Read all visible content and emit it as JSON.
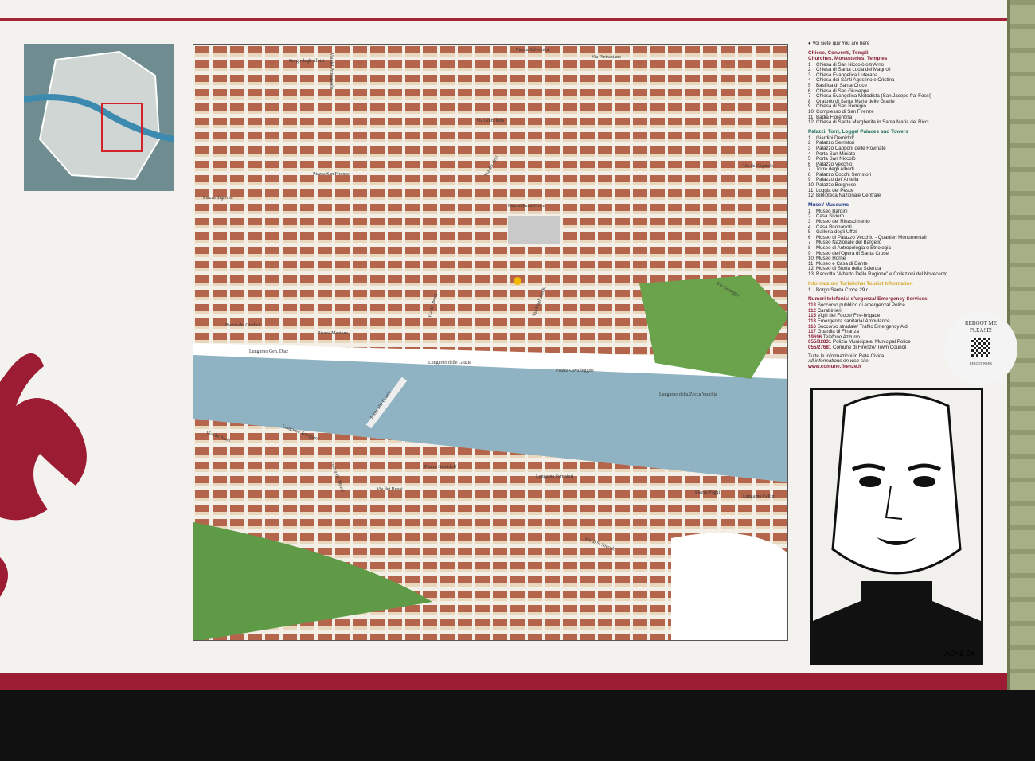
{
  "legend": {
    "you_are_here": "Voi siete qui/ You are here",
    "churches": {
      "title_it": "Chiese, Conventi, Templi",
      "title_en": "Churches, Monasteries, Temples",
      "items": [
        "Chiesa di San Niccolò oltr'Arno",
        "Chiesa di Santa Lucia dei Magnoli",
        "Chiesa Evangelica Luterana",
        "Chiesa dei Santi Agostino e Cristina",
        "Basilica di Santa Croce",
        "Chiesa di San Giuseppe",
        "Chiesa Evangelica Metodista (San Jacopo fra' Fossi)",
        "Oratorio di Santa Maria delle Grazie",
        "Chiesa di San Remigio",
        "Complesso di San Firenze",
        "Badia Fiorentina",
        "Chiesa di Santa Margherita in Santa Maria de' Ricci"
      ]
    },
    "palaces": {
      "title": "Palazzi, Torri, Logge/ Palaces and Towers",
      "items": [
        "Giardini Demidoff",
        "Palazzo Serristori",
        "Palazzo Capponi delle Rovinate",
        "Porta San Miniato",
        "Porta San Niccolò",
        "Palazzo Vecchio",
        "Torre degli Alberti",
        "Palazzo Cocchi Serristori",
        "Palazzo dell'Antella",
        "Palazzo Borghese",
        "Loggia del Pesce",
        "Biblioteca Nazionale Centrale"
      ]
    },
    "museums": {
      "title": "Musei/ Museums",
      "items": [
        "Museo Bardini",
        "Casa Siviero",
        "Museo del Rinascimento",
        "Casa Buonarroti",
        "Galleria degli Uffizi",
        "Museo di Palazzo Vecchio - Quartieri Monumentali",
        "Museo Nazionale del Bargello",
        "Museo di Antropologia e Etnologia",
        "Museo dell'Opera di Santa Croce",
        "Museo Horne",
        "Museo e Casa di Dante",
        "Museo di Storia della Scienza",
        "Raccolta \"Alberto Della Ragione\" e Collezioni del Novecento"
      ]
    },
    "tourist": {
      "title": "Informazioni Turistiche/ Tourist Information",
      "items": [
        "Borgo Santa Croce 29 r"
      ]
    },
    "emergency": {
      "title": "Numeri telefonici d'urgenza/ Emergency Services",
      "items": [
        {
          "num": "113",
          "text": "Soccorso pubblico di emergenza/ Police"
        },
        {
          "num": "112",
          "text": "Carabinieri"
        },
        {
          "num": "115",
          "text": "Vigili del Fuoco/ Fire-brigade"
        },
        {
          "num": "118",
          "text": "Emergenza sanitaria/ Ambulance"
        },
        {
          "num": "116",
          "text": "Soccorso stradale/ Traffic Emergency Aid"
        },
        {
          "num": "117",
          "text": "Guardia di Finanza"
        },
        {
          "num": "19696",
          "text": "Telefono Azzurro"
        },
        {
          "num": "055/32831",
          "text": "Polizia Municipale/ Municipal Police"
        },
        {
          "num": "055/27681",
          "text": "Comune di Firenze/ Town Council"
        }
      ]
    },
    "footer_it": "Tutte le informazioni in Rete Civica",
    "footer_en": "All informations on web-site",
    "website": "www.comune.firenze.it"
  },
  "sticker": {
    "line1": "REBOOT ME",
    "line2": "PLEASE!",
    "brand": "REBOOT WEEK"
  },
  "poster": {
    "signature": "AGHE 24"
  },
  "map_labels": [
    "Piazza Salvemini",
    "Borgo degli Albizi",
    "Via del Proconsolo",
    "Via Pietrapiana",
    "Via Ghibellina",
    "Piazza San Firenze",
    "Piazza Signoria",
    "Via dei Neri",
    "Piazza Santa Croce",
    "Via de' Benci",
    "Via Magliabechi",
    "Via dell'Agnolo",
    "Via Giuseppe",
    "Piazza de' Giudici",
    "Piazza Mentana",
    "Lungarno Gen. Diaz",
    "Lungarno delle Grazie",
    "Piazza Cavalleggeri",
    "Lungarno della Zecca Vecchia",
    "Ponte alle Grazie",
    "Lungarno Torrigiani",
    "Piazza Demidoff",
    "Lungarno Serristori",
    "Via dei Renai",
    "Via di S. Niccolò",
    "Piazza Poggi",
    "Lungarno Cellini",
    "Via dei Bardi",
    "Piazza de' Mozzi"
  ],
  "colors": {
    "brand_red": "#9c1d33",
    "river": "#8fb3c2",
    "buildings": "#b5654c"
  }
}
